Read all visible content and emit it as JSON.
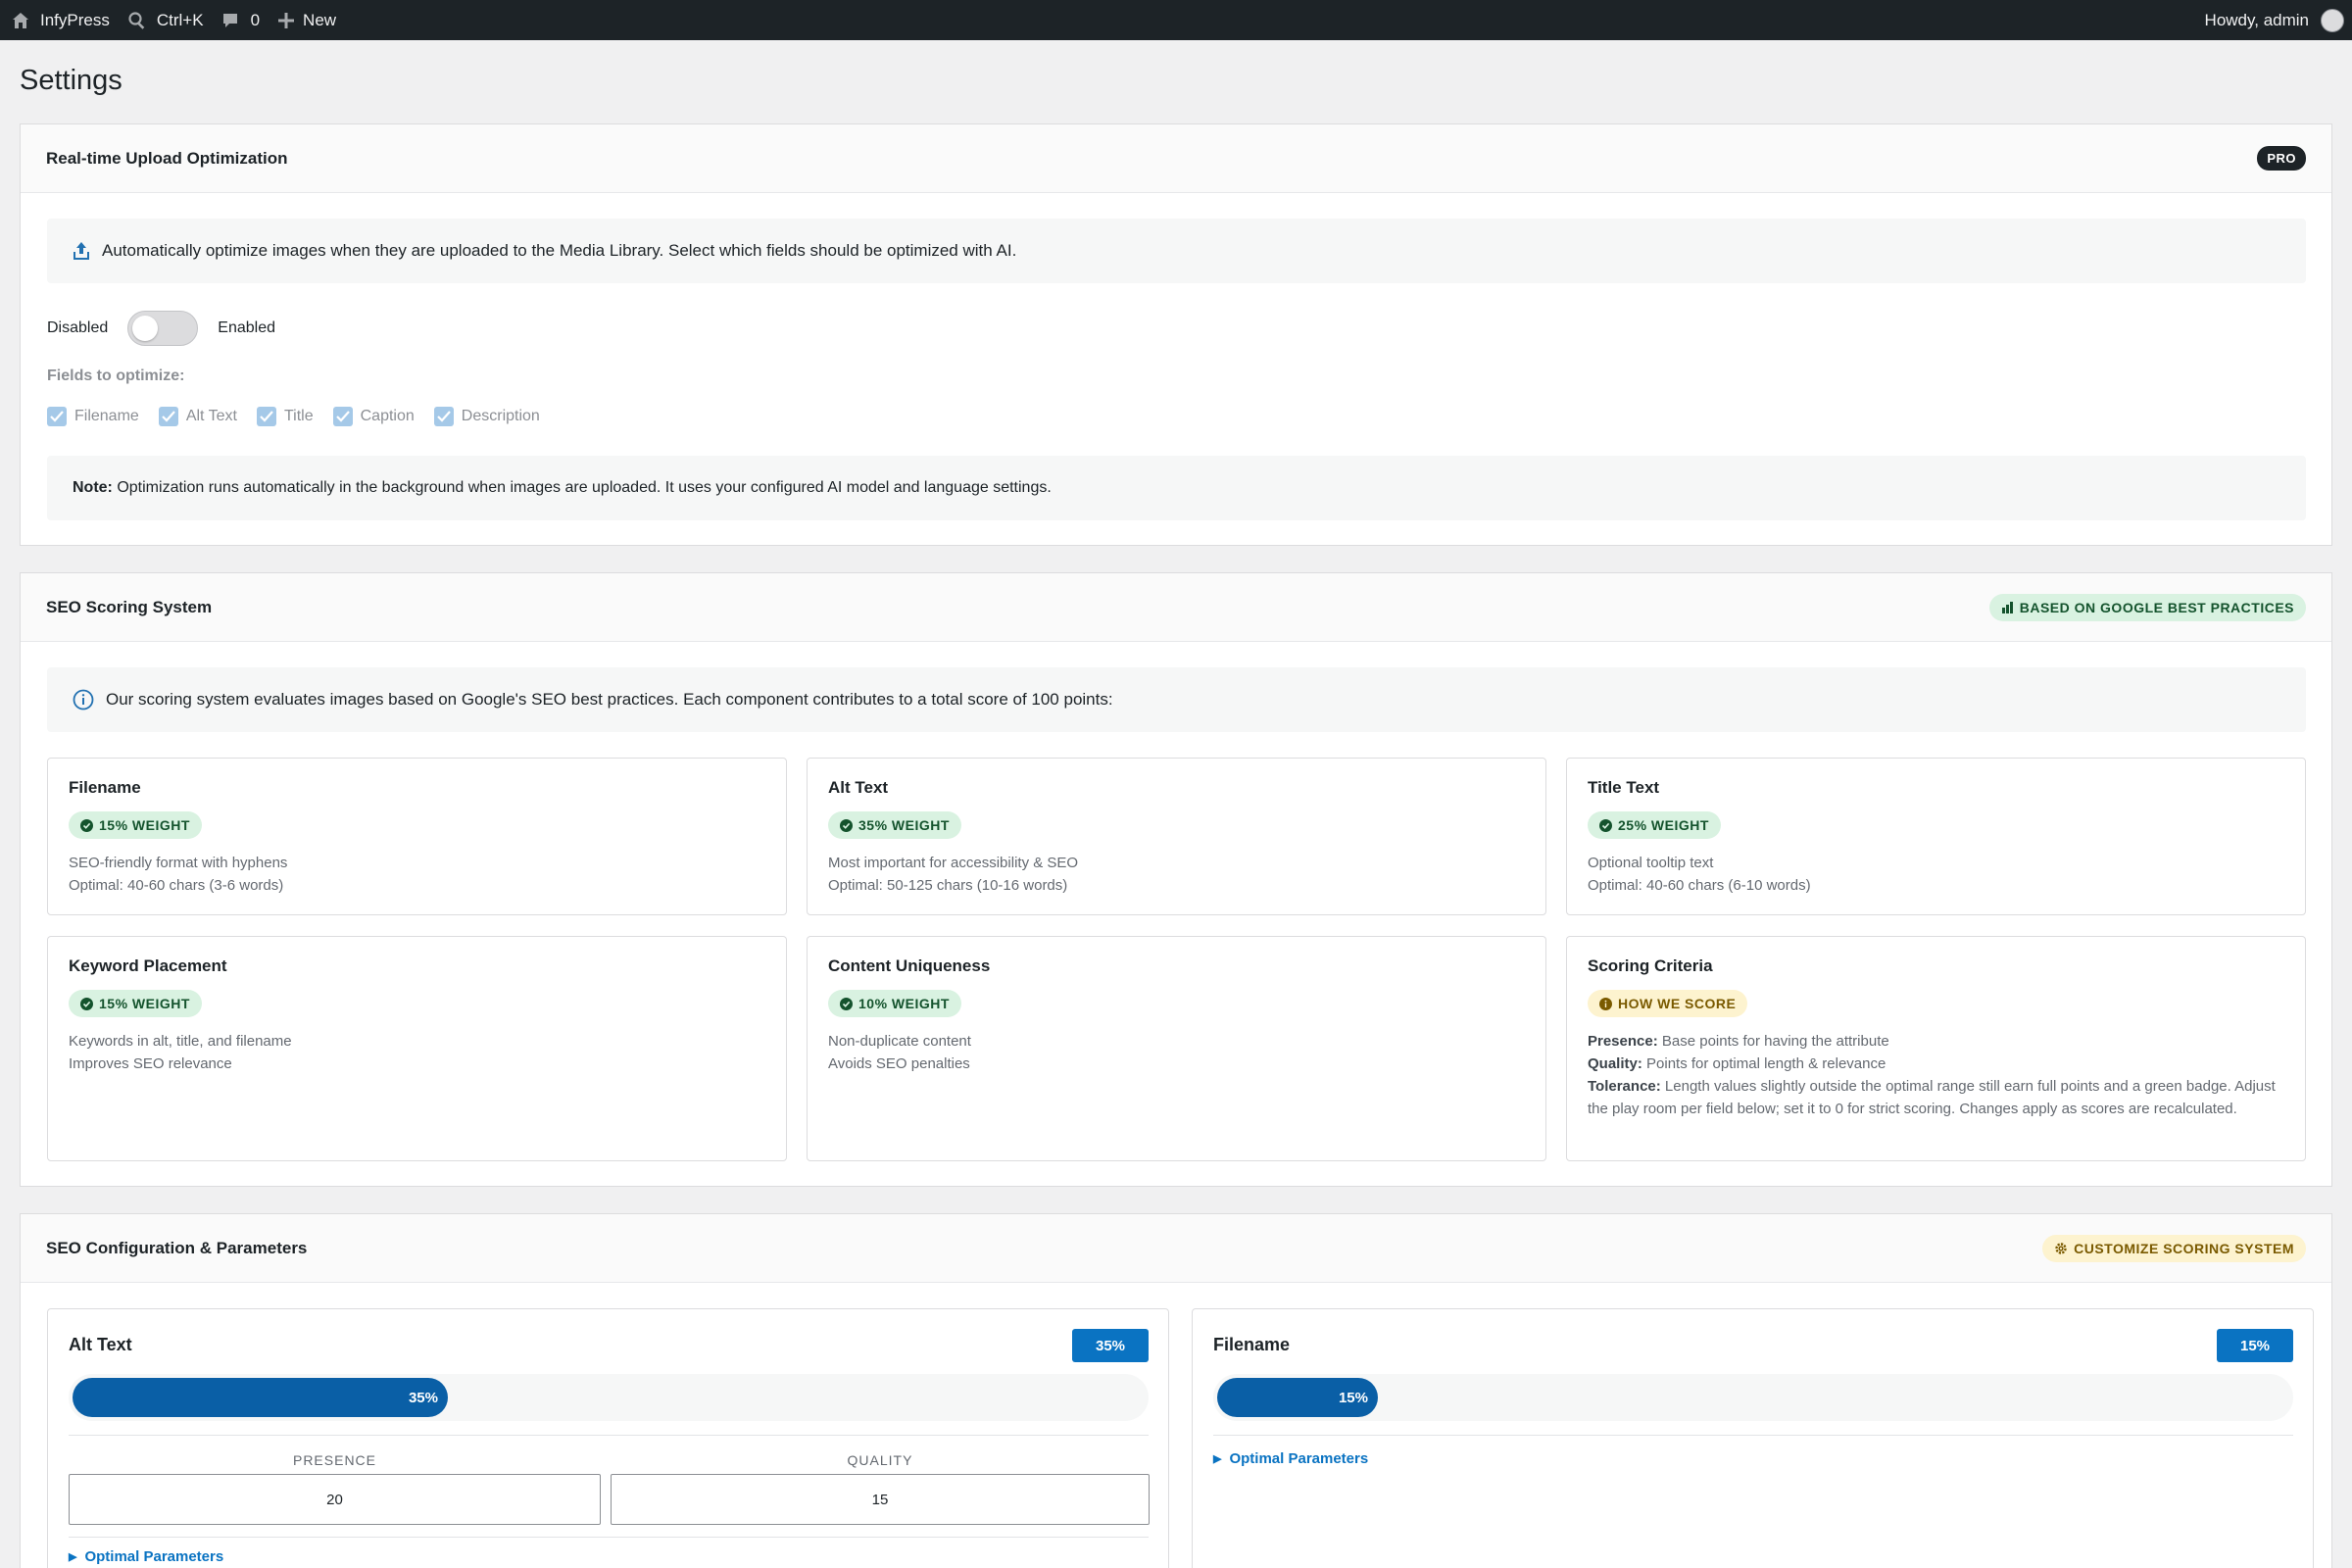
{
  "adminbar": {
    "site_name": "InfyPress",
    "search_shortcut": "Ctrl+K",
    "comments_count": "0",
    "new_label": "New",
    "greeting": "Howdy, admin"
  },
  "page": {
    "title": "Settings"
  },
  "upload": {
    "title": "Real-time Upload Optimization",
    "badge": "PRO",
    "info": "Automatically optimize images when they are uploaded to the Media Library. Select which fields should be optimized with AI.",
    "toggle_off_label": "Disabled",
    "toggle_on_label": "Enabled",
    "toggle_enabled": false,
    "fields_label": "Fields to optimize:",
    "fields": [
      {
        "label": "Filename",
        "checked": true
      },
      {
        "label": "Alt Text",
        "checked": true
      },
      {
        "label": "Title",
        "checked": true
      },
      {
        "label": "Caption",
        "checked": true
      },
      {
        "label": "Description",
        "checked": true
      }
    ],
    "note_label": "Note:",
    "note_text": " Optimization runs automatically in the background when images are uploaded. It uses your configured AI model and language settings."
  },
  "scoring": {
    "title": "SEO Scoring System",
    "badge": "BASED ON GOOGLE BEST PRACTICES",
    "info": "Our scoring system evaluates images based on Google's SEO best practices. Each component contributes to a total score of 100 points:",
    "cards": [
      {
        "title": "Filename",
        "badge": "15% WEIGHT",
        "line1": "SEO-friendly format with hyphens",
        "line2": "Optimal: 40-60 chars (3-6 words)"
      },
      {
        "title": "Alt Text",
        "badge": "35% WEIGHT",
        "line1": "Most important for accessibility & SEO",
        "line2": "Optimal: 50-125 chars (10-16 words)"
      },
      {
        "title": "Title Text",
        "badge": "25% WEIGHT",
        "line1": "Optional tooltip text",
        "line2": "Optimal: 40-60 chars (6-10 words)"
      },
      {
        "title": "Keyword Placement",
        "badge": "15% WEIGHT",
        "line1": "Keywords in alt, title, and filename",
        "line2": "Improves SEO relevance"
      },
      {
        "title": "Content Uniqueness",
        "badge": "10% WEIGHT",
        "line1": "Non-duplicate content",
        "line2": "Avoids SEO penalties"
      }
    ],
    "criteria": {
      "title": "Scoring Criteria",
      "badge": "HOW WE SCORE",
      "presence_label": "Presence:",
      "presence_text": " Base points for having the attribute",
      "quality_label": "Quality:",
      "quality_text": " Points for optimal length & relevance",
      "tolerance_label": "Tolerance:",
      "tolerance_text": " Length values slightly outside the optimal range still earn full points and a green badge. Adjust the play room per field below; set it to 0 for strict scoring. Changes apply as scores are recalculated."
    }
  },
  "config": {
    "title": "SEO Configuration & Parameters",
    "badge": "CUSTOMIZE SCORING SYSTEM",
    "alt": {
      "title": "Alt Text",
      "pct_label": "35%",
      "weight": 35,
      "presence_label": "PRESENCE",
      "quality_label": "QUALITY",
      "presence_value": "20",
      "quality_value": "15",
      "optimal_label": "Optimal Parameters"
    },
    "filename": {
      "title": "Filename",
      "pct_label": "15%",
      "weight": 15,
      "optimal_label": "Optimal Parameters"
    }
  },
  "colors": {
    "accent": "#0a73c2",
    "bar_fill": "#0a5fa6",
    "green_badge_bg": "#d9f2e1",
    "yellow_badge_bg": "#fdf3cf",
    "adminbar_bg": "#1d2327"
  }
}
